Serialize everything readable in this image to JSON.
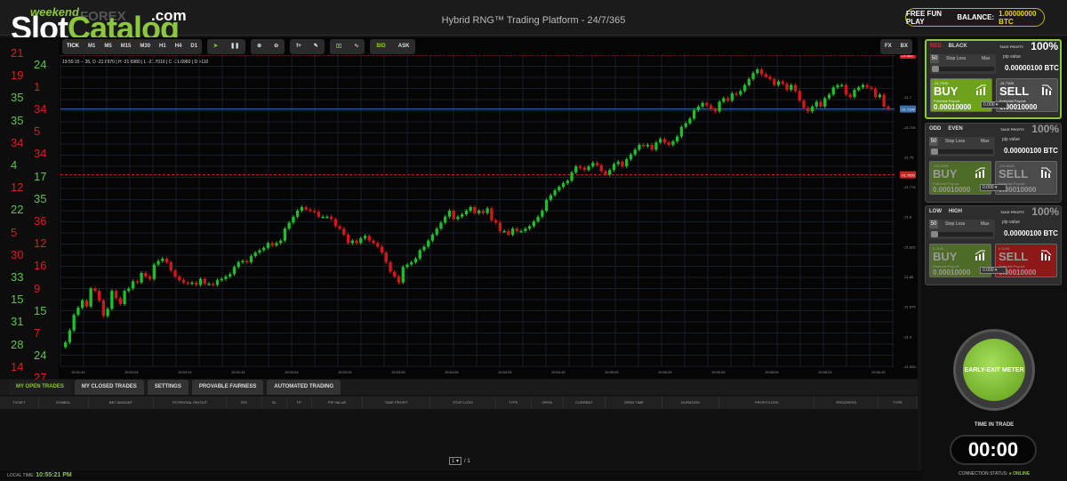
{
  "header": {
    "logo_top": "weekend",
    "logo_brand": "FOREX",
    "logo_main_a": "Slot",
    "logo_main_b": "Catalog",
    "logo_domain": ".com",
    "title": "Hybrid RNG™ Trading Platform - 24/7/365",
    "fun_play": "FREE FUN PLAY",
    "balance_label": "BALANCE:",
    "balance_value": "1.00000000 BTC"
  },
  "toolbar": {
    "timeframes": [
      "TICK",
      "M1",
      "M5",
      "M15",
      "M30",
      "H1",
      "H4",
      "D1"
    ],
    "right_buttons": [
      "FX",
      "BX"
    ]
  },
  "left_numbers": [
    {
      "v": "21",
      "c": "#d42020"
    },
    {
      "v": "24",
      "c": "#5cc44a"
    },
    {
      "v": "19",
      "c": "#d42020"
    },
    {
      "v": "1",
      "c": "#d42020"
    },
    {
      "v": "35",
      "c": "#5cc44a"
    },
    {
      "v": "34",
      "c": "#d42020"
    },
    {
      "v": "35",
      "c": "#5cc44a"
    },
    {
      "v": "5",
      "c": "#d42020"
    },
    {
      "v": "34",
      "c": "#d42020"
    },
    {
      "v": "34",
      "c": "#d42020"
    },
    {
      "v": "4",
      "c": "#5cc44a"
    },
    {
      "v": "17",
      "c": "#5cc44a"
    },
    {
      "v": "12",
      "c": "#d42020"
    },
    {
      "v": "35",
      "c": "#5cc44a"
    },
    {
      "v": "22",
      "c": "#5cc44a"
    },
    {
      "v": "36",
      "c": "#d42020"
    },
    {
      "v": "5",
      "c": "#d42020"
    },
    {
      "v": "12",
      "c": "#d42020"
    },
    {
      "v": "30",
      "c": "#d42020"
    },
    {
      "v": "16",
      "c": "#d42020"
    },
    {
      "v": "33",
      "c": "#5cc44a"
    },
    {
      "v": "9",
      "c": "#d42020"
    },
    {
      "v": "15",
      "c": "#5cc44a"
    },
    {
      "v": "15",
      "c": "#5cc44a"
    },
    {
      "v": "31",
      "c": "#5cc44a"
    },
    {
      "v": "7",
      "c": "#d42020"
    },
    {
      "v": "28",
      "c": "#5cc44a"
    },
    {
      "v": "24",
      "c": "#5cc44a"
    },
    {
      "v": "14",
      "c": "#d42020"
    },
    {
      "v": "27",
      "c": "#d42020"
    }
  ],
  "chart_info": "19:55:15 -- 35, O -21.6970 | H -21.6980 | L -21.7010 | C -21.6960 | D +110",
  "chart_data": {
    "type": "candlestick",
    "ylim": [
      -21.925,
      -21.665
    ],
    "y_ticks": [
      "-21.7",
      "-21.725",
      "-21.75",
      "-21.775",
      "-21.8",
      "-21.825",
      "-21.85",
      "-21.875",
      "-21.9",
      "-21.925"
    ],
    "x_ticks": [
      "19:51:44",
      "19:52:04",
      "19:52:24",
      "19:52:44",
      "19:53:04",
      "19:53:25",
      "19:53:45",
      "19:54:05",
      "19:54:25",
      "19:54:45",
      "19:55:05",
      "19:55:25",
      "19:55:45",
      "19:56:05",
      "19:56:24",
      "19:56:45"
    ],
    "ref_lines": [
      {
        "label": "-21.665",
        "value": -21.665,
        "color": "#cc2222"
      },
      {
        "label": "-21.7100",
        "value": -21.71,
        "color": "#3a6fa8"
      },
      {
        "label": "-21.7650",
        "value": -21.765,
        "color": "#cc2222"
      }
    ],
    "closes": [
      -21.905,
      -21.895,
      -21.882,
      -21.876,
      -21.87,
      -21.875,
      -21.86,
      -21.862,
      -21.87,
      -21.883,
      -21.877,
      -21.862,
      -21.868,
      -21.873,
      -21.862,
      -21.86,
      -21.854,
      -21.855,
      -21.847,
      -21.85,
      -21.852,
      -21.84,
      -21.837,
      -21.835,
      -21.838,
      -21.845,
      -21.85,
      -21.853,
      -21.855,
      -21.856,
      -21.855,
      -21.857,
      -21.852,
      -21.856,
      -21.856,
      -21.857,
      -21.853,
      -21.852,
      -21.85,
      -21.848,
      -21.842,
      -21.838,
      -21.837,
      -21.838,
      -21.833,
      -21.83,
      -21.828,
      -21.826,
      -21.822,
      -21.824,
      -21.822,
      -21.82,
      -21.81,
      -21.805,
      -21.8,
      -21.795,
      -21.792,
      -21.794,
      -21.795,
      -21.796,
      -21.8,
      -21.8,
      -21.8,
      -21.802,
      -21.808,
      -21.81,
      -21.815,
      -21.822,
      -21.82,
      -21.822,
      -21.818,
      -21.816,
      -21.82,
      -21.822,
      -21.825,
      -21.83,
      -21.838,
      -21.846,
      -21.85,
      -21.855,
      -21.842,
      -21.84,
      -21.838,
      -21.835,
      -21.828,
      -21.825,
      -21.82,
      -21.815,
      -21.81,
      -21.805,
      -21.8,
      -21.795,
      -21.802,
      -21.8,
      -21.798,
      -21.795,
      -21.792,
      -21.797,
      -21.795,
      -21.797,
      -21.793,
      -21.803,
      -21.805,
      -21.812,
      -21.812,
      -21.815,
      -21.81,
      -21.812,
      -21.812,
      -21.81,
      -21.808,
      -21.804,
      -21.8,
      -21.795,
      -21.786,
      -21.782,
      -21.778,
      -21.775,
      -21.772,
      -21.77,
      -21.763,
      -21.758,
      -21.759,
      -21.761,
      -21.758,
      -21.755,
      -21.757,
      -21.762,
      -21.765,
      -21.761,
      -21.756,
      -21.754,
      -21.758,
      -21.752,
      -21.748,
      -21.744,
      -21.74,
      -21.741,
      -21.74,
      -21.744,
      -21.738,
      -21.735,
      -21.738,
      -21.74,
      -21.737,
      -21.733,
      -21.725,
      -21.722,
      -21.718,
      -21.711,
      -21.708,
      -21.705,
      -21.707,
      -21.71,
      -21.712,
      -21.704,
      -21.701,
      -21.703,
      -21.697,
      -21.698,
      -21.695,
      -21.69,
      -21.685,
      -21.68,
      -21.677,
      -21.681,
      -21.683,
      -21.685,
      -21.69,
      -21.687,
      -21.689,
      -21.694,
      -21.69,
      -21.695,
      -21.703,
      -21.709,
      -21.712,
      -21.708,
      -21.704,
      -21.708,
      -21.701,
      -21.698,
      -21.692,
      -21.69,
      -21.69,
      -21.698,
      -21.7,
      -21.694,
      -21.692,
      -21.69,
      -21.692,
      -21.693,
      -21.7,
      -21.698,
      -21.708,
      -21.71
    ]
  },
  "bottom_tabs": [
    "MY OPEN TRADES",
    "MY CLOSED TRADES",
    "SETTINGS",
    "PROVABLE FAIRNESS",
    "AUTOMATED TRADING"
  ],
  "table_headers": [
    "TICKET",
    "SYMBOL",
    "BET AMOUNT",
    "POTENTIAL PAYOUT",
    "R/S",
    "SL",
    "TP",
    "PIP VALUE",
    "TAKE PROFIT",
    "STOP LOSS",
    "TYPE",
    "OPEN",
    "CURRENT",
    "OPEN TIME",
    "DURATION",
    "PROFIT/LOSS",
    "PROGRESS",
    "TYPE"
  ],
  "pager": {
    "page": "1",
    "of": "/ 1"
  },
  "footer": {
    "label": "LOCAL TIME:",
    "time": "10:55:21 PM"
  },
  "cards": [
    {
      "opt_a": "RED",
      "opt_b": "BLACK",
      "take_profit": "TAKE PROFIT:",
      "pct": "100%",
      "sl_num": "50",
      "sl_label": "Stop Loss",
      "sl_max": "Max",
      "pip_label": "pip value",
      "pip_value": "0.00000100 BTC",
      "buy_price": "-21.7100",
      "sell_price": "-21.7100",
      "buy": "BUY",
      "sell": "SELL",
      "payout_label": "Potential Payout:",
      "buy_payout": "0.00010000",
      "sell_payout": "0.00010000",
      "amount": "0.000"
    },
    {
      "opt_a": "ODD",
      "opt_b": "EVEN",
      "take_profit": "TAKE PROFIT:",
      "pct": "100%",
      "sl_num": "50",
      "sl_label": "Stop Loss",
      "sl_max": "Max",
      "pip_label": "pip value",
      "pip_value": "0.00000100 BTC",
      "buy_price": "-101.6800",
      "sell_price": "-101.6800",
      "buy": "BUY",
      "sell": "SELL",
      "payout_label": "Potential Payout:",
      "buy_payout": "0.00010000",
      "sell_payout": "0.00010000",
      "amount": "0.000"
    },
    {
      "opt_a": "LOW",
      "opt_b": "HIGH",
      "take_profit": "TAKE PROFIT:",
      "pct": "100%",
      "sl_num": "50",
      "sl_label": "Stop Loss",
      "sl_max": "Max",
      "pip_label": "pip value",
      "pip_value": "0.00000100 BTC",
      "buy_price": "0.2100",
      "sell_price": "0.2100",
      "buy": "BUY",
      "sell": "SELL",
      "payout_label": "Potential Payout:",
      "buy_payout": "0.00010000",
      "sell_payout": "0.00010000",
      "amount": "0.000"
    }
  ],
  "early_exit": "EARLY-EXIT METER",
  "time_in_trade_label": "TIME IN TRADE",
  "time_in_trade": "00:00",
  "connection": {
    "label": "CONNECTION STATUS:",
    "status": "ONLINE"
  }
}
